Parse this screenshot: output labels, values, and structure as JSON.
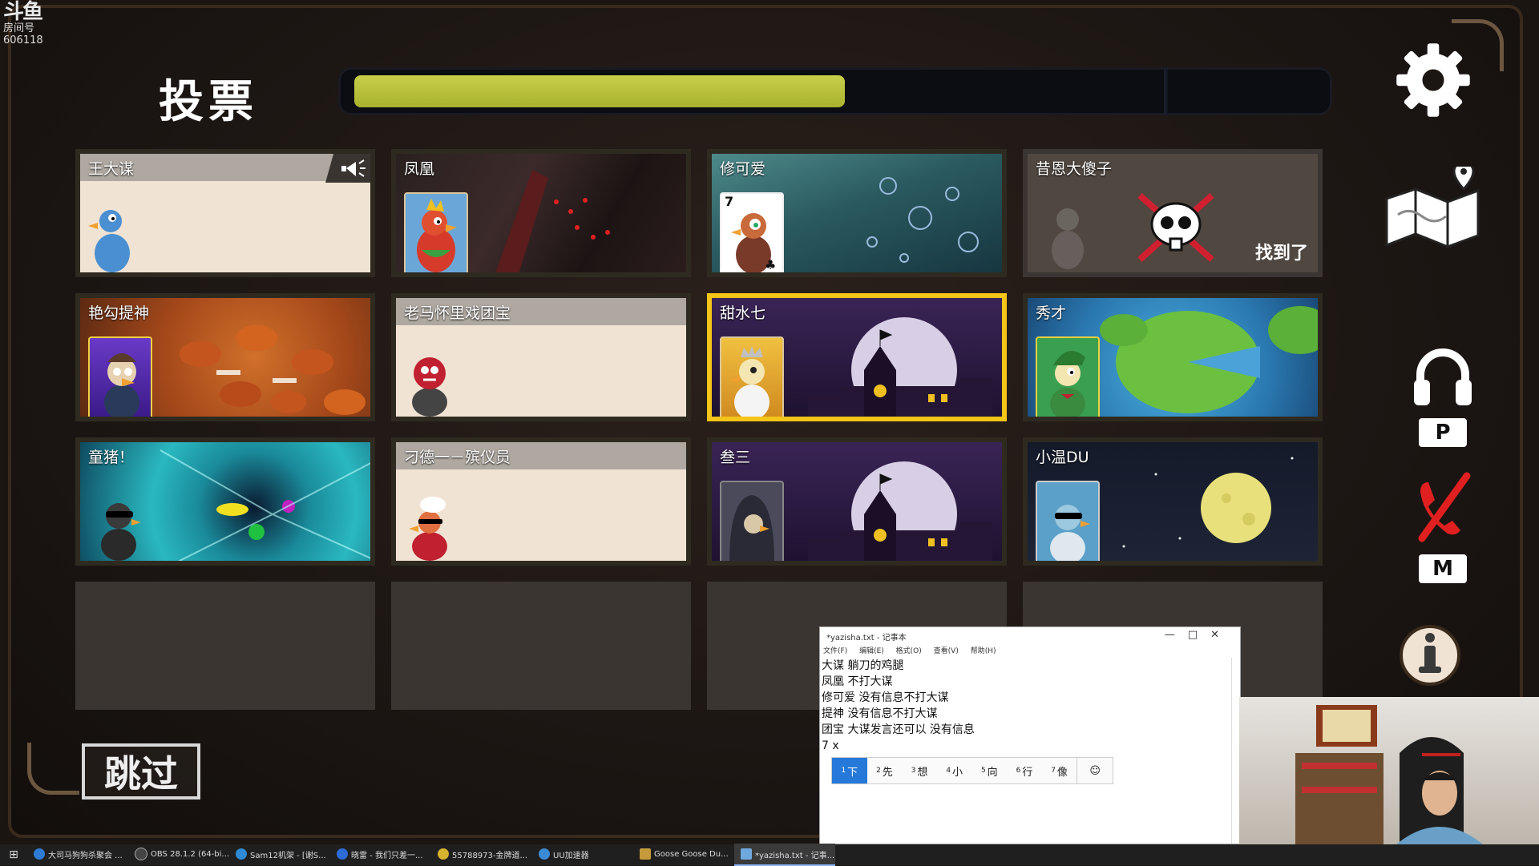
{
  "watermark": {
    "logo": "斗鱼",
    "room_label": "房间号",
    "room_id": "606118"
  },
  "title": "投票",
  "timer": {
    "progress": 0.51
  },
  "players": [
    {
      "name": "王大谋",
      "speaking": true
    },
    {
      "name": "凤凰"
    },
    {
      "name": "修可爱",
      "card_rank": "7"
    },
    {
      "name": "昔恩大傻子",
      "status": "找到了"
    },
    {
      "name": "艳勾提神"
    },
    {
      "name": "老马怀里戏团宝"
    },
    {
      "name": "甜水七",
      "selected": true
    },
    {
      "name": "秀才"
    },
    {
      "name": "童猪！"
    },
    {
      "name": "刁德一－殡仪员"
    },
    {
      "name": "叁三"
    },
    {
      "name": "小温DU"
    }
  ],
  "skip_label": "跳过",
  "side_buttons": {
    "push_to_talk_key": "P",
    "mute_key": "M"
  },
  "notepad": {
    "title": "*yazisha.txt - 记事本",
    "menu": [
      "文件(F)",
      "编辑(E)",
      "格式(O)",
      "查看(V)",
      "帮助(H)"
    ],
    "lines": [
      "大谋 躺刀的鸡腿",
      "凤凰 不打大谋",
      "修可爱 没有信息不打大谋",
      "提神 没有信息不打大谋",
      "团宝  大谋发言还可以 没有信息",
      "7 x"
    ],
    "ime": [
      {
        "num": "1",
        "char": "下"
      },
      {
        "num": "2",
        "char": "先"
      },
      {
        "num": "3",
        "char": "想"
      },
      {
        "num": "4",
        "char": "小"
      },
      {
        "num": "5",
        "char": "向"
      },
      {
        "num": "6",
        "char": "行"
      },
      {
        "num": "7",
        "char": "像"
      }
    ],
    "ime_emoji": "☺"
  },
  "taskbar": [
    {
      "label": "大司马狗狗杀聚会 ...",
      "color": "#2e7bd6"
    },
    {
      "label": "OBS 28.1.2 (64-bi...",
      "color": "#444"
    },
    {
      "label": "Sam12机架 - [谢S...",
      "color": "#2e8ad6"
    },
    {
      "label": "晓雷 - 我们只差一...",
      "color": "#2d6cd6"
    },
    {
      "label": "55788973-金牌道...",
      "color": "#d6b22e"
    },
    {
      "label": "UU加速器",
      "color": "#3a8ad6"
    },
    {
      "label": "Goose Goose Du...",
      "color": "#c59a3a"
    },
    {
      "label": "*yazisha.txt - 记事...",
      "color": "#6fa8dc",
      "active": true
    }
  ],
  "colors": {
    "selected_border": "#f5c518",
    "timer_fill": "#b8bf3a",
    "ime_highlight": "#2679d8"
  }
}
